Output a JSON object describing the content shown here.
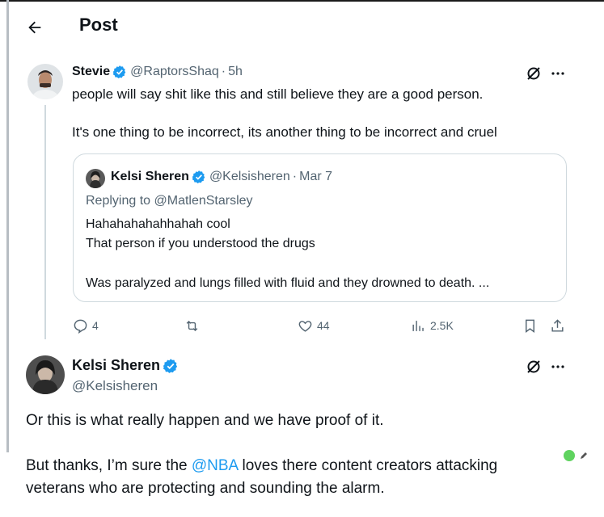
{
  "header": {
    "title": "Post"
  },
  "tweet": {
    "name": "Stevie",
    "handle": "@RaptorsShaq",
    "time": "5h",
    "text_line1": "people will say shit like this and still believe they are a good person.",
    "text_line2": "It's one thing to be incorrect, its another thing to be incorrect and cruel",
    "quote": {
      "name": "Kelsi Sheren",
      "handle": "@Kelsisheren",
      "time": "Mar 7",
      "replying_to": "Replying to @MatlenStarsley",
      "line1": "Hahahahahahhahah cool",
      "line2": "That person if you understood the drugs",
      "line3": "Was paralyzed and lungs filled with fluid and they drowned to death. ..."
    },
    "actions": {
      "replies": "4",
      "likes": "44",
      "views": "2.5K"
    }
  },
  "reply": {
    "name": "Kelsi Sheren",
    "handle": "@Kelsisheren",
    "line1": "Or this is what really happen and we have proof of it.",
    "line2_pre": "But thanks, I’m sure the ",
    "line2_mention": "@NBA",
    "line2_post": " loves there content creators attacking",
    "line3": "veterans who are protecting and sounding the alarm."
  },
  "dot_separator": "·",
  "colors": {
    "accent": "#1d9bf0",
    "secondary_text": "#536471",
    "border": "#cfd9de",
    "status_dot": "#5fd35f"
  },
  "icons": [
    "back-arrow-icon",
    "verified-badge-icon",
    "grok-icon",
    "more-icon",
    "reply-icon",
    "retweet-icon",
    "like-icon",
    "views-icon",
    "bookmark-icon",
    "share-icon",
    "pencil-icon"
  ]
}
